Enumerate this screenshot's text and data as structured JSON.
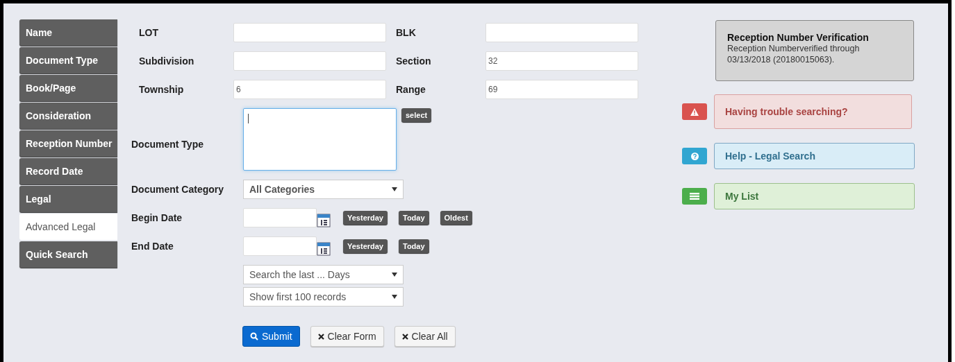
{
  "sidebar": {
    "items": [
      {
        "label": "Name",
        "selected": false
      },
      {
        "label": "Document Type",
        "selected": false
      },
      {
        "label": "Book/Page",
        "selected": false
      },
      {
        "label": "Consideration",
        "selected": false
      },
      {
        "label": "Reception Number",
        "selected": false
      },
      {
        "label": "Record Date",
        "selected": false
      },
      {
        "label": "Legal",
        "selected": false
      },
      {
        "label": "Advanced Legal",
        "selected": true
      },
      {
        "label": "Quick Search",
        "selected": false
      }
    ]
  },
  "legal_rows": [
    [
      {
        "label": "LOT"
      },
      {
        "label": "BLK"
      }
    ],
    [
      {
        "label": "Subdivision"
      },
      {
        "label": "Section",
        "value": "32"
      }
    ],
    [
      {
        "label": "Township",
        "value": "6"
      },
      {
        "label": "Range",
        "value": "69"
      }
    ]
  ],
  "document_type": {
    "label": "Document Type",
    "focused": true,
    "button": "select"
  },
  "document_category": {
    "label": "Document Category",
    "value": "All Categories"
  },
  "dates": [
    {
      "label": "Begin Date",
      "buttons": [
        "Yesterday",
        "Today",
        "Oldest"
      ]
    },
    {
      "label": "End Date",
      "buttons": [
        "Yesterday",
        "Today"
      ]
    }
  ],
  "selects": [
    "Search the last ... Days",
    "Show first 100 records"
  ],
  "actions": [
    {
      "label": "Submit",
      "kind": "primary"
    },
    {
      "label": "Clear Form",
      "kind": "clear"
    },
    {
      "label": "Clear All",
      "kind": "clear"
    }
  ],
  "verification": {
    "title": "Reception Number Verification",
    "text": "Reception Numberverified through 03/13/2018 (20180015063)."
  },
  "links": [
    {
      "label": "Having trouble searching?",
      "kind": "danger"
    },
    {
      "label": "Help - Legal Search",
      "kind": "info"
    },
    {
      "label": "My List",
      "kind": "success"
    }
  ]
}
